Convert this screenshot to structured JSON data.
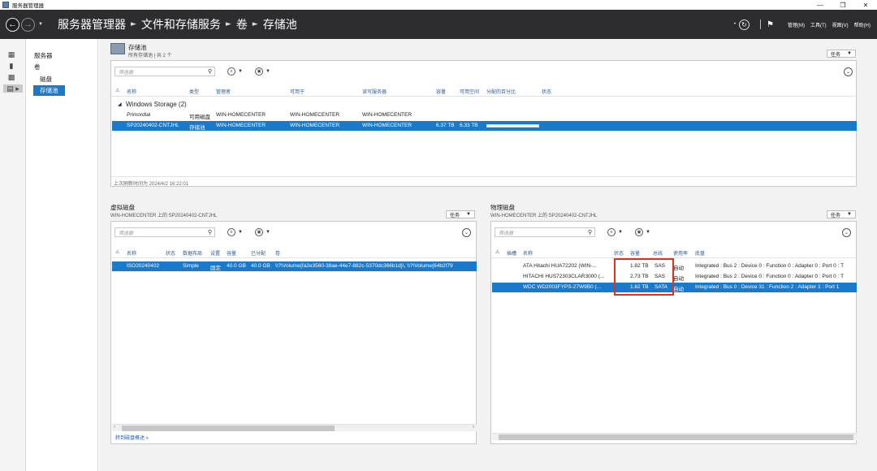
{
  "window": {
    "title": "服务器管理器",
    "minimize": "—",
    "maximize": "❐",
    "close": "✕"
  },
  "header": {
    "breadcrumb": [
      "服务器管理器",
      "文件和存储服务",
      "卷",
      "存储池"
    ],
    "menus": [
      "管理(M)",
      "工具(T)",
      "视图(V)",
      "帮助(H)"
    ]
  },
  "nav": {
    "items": [
      "服务器",
      "卷",
      "磁盘",
      "存储池"
    ]
  },
  "storage_pools": {
    "title": "存储池",
    "subtitle": "所有存储池 | 共 2 个",
    "tasks": "任务",
    "filter_placeholder": "筛选器",
    "columns": [
      "名称",
      "类型",
      "管理者",
      "可用于",
      "读写服务器",
      "容量",
      "可用空间",
      "分配的百分比",
      "状态"
    ],
    "group": "Windows Storage (2)",
    "rows": [
      {
        "name": "Primordial",
        "type": "可用磁盘",
        "managed_by": "WIN-HOMECENTER",
        "available_to": "WIN-HOMECENTER",
        "rw_server": "WIN-HOMECENTER",
        "capacity": "",
        "free": ""
      },
      {
        "name": "SP20240402-CNTJHL",
        "type": "存储池",
        "managed_by": "WIN-HOMECENTER",
        "available_to": "WIN-HOMECENTER",
        "rw_server": "WIN-HOMECENTER",
        "capacity": "6.37 TB",
        "free": "6.33 TB"
      }
    ],
    "last_refresh": "上次刷新时间为 2024/4/2 16:22:01"
  },
  "virtual_disks": {
    "title": "虚拟磁盘",
    "subtitle": "WIN-HOMECENTER 上的 SP20240402-CNTJHL",
    "tasks": "任务",
    "filter_placeholder": "筛选器",
    "columns": [
      "名称",
      "状态",
      "数据布局",
      "设置",
      "容量",
      "已分配",
      "卷"
    ],
    "rows": [
      {
        "name": "ISO20240402",
        "status": "",
        "layout": "Simple",
        "provisioning": "固定",
        "capacity": "40.0 GB",
        "allocated": "40.0 GB",
        "volume": "\\\\?\\Volume{fa2e3560-38ae-44e7-882c-5370dc366b1d}\\, \\\\?\\Volume{64b2f79"
      }
    ],
    "link": "转到磁盘概述 »"
  },
  "physical_disks": {
    "title": "物理磁盘",
    "subtitle": "WIN-HOMECENTER 上的 SP20240402-CNTJHL",
    "tasks": "任务",
    "filter_placeholder": "筛选器",
    "columns": [
      "插槽",
      "名称",
      "状态",
      "容量",
      "总线",
      "使用率",
      "底盘"
    ],
    "rows": [
      {
        "name": "ATA Hitachi HUA72202 (WIN-...",
        "capacity": "1.82 TB",
        "bus": "SAS",
        "usage": "自动",
        "chassis": "Integrated : Bus 2 : Device 0 : Function 0 : Adapter 0 : Port 0 : T"
      },
      {
        "name": "HITACHI HUS72303CLAR3000 (...",
        "capacity": "2.73 TB",
        "bus": "SAS",
        "usage": "自动",
        "chassis": "Integrated : Bus 2 : Device 0 : Function 0 : Adapter 0 : Port 0 : T"
      },
      {
        "name": "WDC WD2003FYPS-27W9B0 (...",
        "capacity": "1.82 TB",
        "bus": "SATA",
        "usage": "自动",
        "chassis": "Integrated : Bus 0 : Device 31 : Function 2 : Adapter 1 : Port 1"
      }
    ]
  },
  "colors": {
    "accent": "#1979ca",
    "header_bg": "#2d2d30",
    "highlight": "#e0301e"
  }
}
